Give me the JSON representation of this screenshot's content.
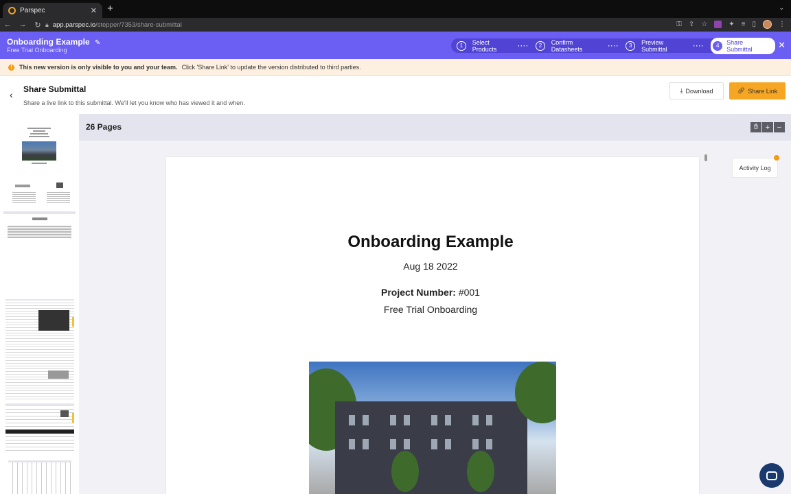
{
  "browser": {
    "tab_title": "Parspec",
    "tab_close": "✕",
    "new_tab": "+",
    "url_host": "app.parspec.io",
    "url_path": "/stepper/7353/share-submittal"
  },
  "header": {
    "project_title": "Onboarding Example",
    "project_subtitle": "Free Trial Onboarding",
    "steps": [
      {
        "num": "1",
        "label": "Select Products"
      },
      {
        "num": "2",
        "label": "Confirm Datasheets"
      },
      {
        "num": "3",
        "label": "Preview Submittal"
      },
      {
        "num": "4",
        "label": "Share Submittal"
      }
    ],
    "active_step": 4,
    "close": "✕"
  },
  "banner": {
    "strong": "This new version is only visible to you and your team.",
    "text": "Click 'Share Link' to update the version distributed to third parties.",
    "color": "#fdf0e0"
  },
  "share": {
    "title": "Share Submittal",
    "description": "Share a live link to this submittal. We'll let you know who has viewed it and when.",
    "download_label": "Download",
    "share_label": "Share Link"
  },
  "viewer": {
    "pages_label": "26 Pages",
    "activity_log": "Activity Log"
  },
  "document": {
    "title": "Onboarding Example",
    "date": "Aug 18 2022",
    "project_number_label": "Project Number:",
    "project_number_value": "#001",
    "subtitle": "Free Trial Onboarding"
  },
  "colors": {
    "header": "#6b5ef2",
    "accent": "#f6a623"
  }
}
